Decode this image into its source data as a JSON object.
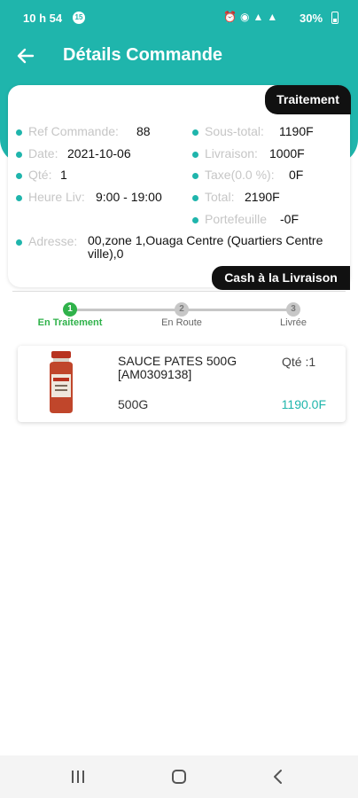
{
  "status_bar": {
    "time": "10 h 54",
    "badge": "15",
    "battery": "30%"
  },
  "header": {
    "title": "Détails Commande"
  },
  "order": {
    "status_badge": "Traitement",
    "left": [
      {
        "label": "Ref Commande:",
        "value": "88"
      },
      {
        "label": "Date:",
        "value": "2021-10-06"
      },
      {
        "label": "Qté:",
        "value": "1"
      },
      {
        "label": "Heure Liv:",
        "value": "9:00 - 19:00"
      }
    ],
    "right": [
      {
        "label": "Sous-total:",
        "value": "1190F"
      },
      {
        "label": "Livraison:",
        "value": "1000F"
      },
      {
        "label": "Taxe(0.0 %):",
        "value": "0F"
      },
      {
        "label": "Total:",
        "value": "2190F"
      },
      {
        "label": "Portefeuille",
        "value": "-0F"
      }
    ],
    "address": {
      "label": "Adresse:",
      "value": "00,zone 1,Ouaga Centre (Quartiers Centre ville),0"
    },
    "payment_badge": "Cash à la Livraison"
  },
  "tracker": {
    "steps": [
      {
        "num": "1",
        "label": "En Traitement"
      },
      {
        "num": "2",
        "label": "En Route"
      },
      {
        "num": "3",
        "label": "Livrée"
      }
    ]
  },
  "product": {
    "name": "SAUCE PATES 500G [AM0309138]",
    "qty": "Qté :1",
    "size": "500G",
    "price": "1190.0F"
  },
  "colors": {
    "accent": "#1fb5ac",
    "active_step": "#2fb24a"
  }
}
